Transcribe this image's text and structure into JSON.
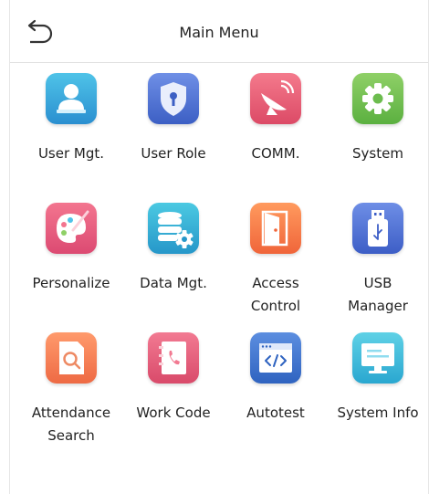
{
  "header": {
    "title": "Main Menu"
  },
  "menu": [
    {
      "label": "User Mgt.",
      "icon": "user-management-icon",
      "color_top": "#4fc3e8",
      "color_bottom": "#2a8fd0"
    },
    {
      "label": "User Role",
      "icon": "user-role-shield-icon",
      "color_top": "#6f8fe6",
      "color_bottom": "#3c5fc4"
    },
    {
      "label": "COMM.",
      "icon": "satellite-dish-icon",
      "color_top": "#f47a8c",
      "color_bottom": "#dc4a66"
    },
    {
      "label": "System",
      "icon": "gear-icon",
      "color_top": "#8fd067",
      "color_bottom": "#5bb040"
    },
    {
      "label": "Personalize",
      "icon": "palette-icon",
      "color_top": "#f3758f",
      "color_bottom": "#dc4a72"
    },
    {
      "label": "Data Mgt.",
      "icon": "database-gear-icon",
      "color_top": "#4bc9e2",
      "color_bottom": "#2697c9"
    },
    {
      "label": "Access\nControl",
      "icon": "door-icon",
      "color_top": "#ff9a5e",
      "color_bottom": "#f0653a"
    },
    {
      "label": "USB\nManager",
      "icon": "usb-drive-icon",
      "color_top": "#6e8ee6",
      "color_bottom": "#3d5ec6"
    },
    {
      "label": "Attendance\nSearch",
      "icon": "document-search-icon",
      "color_top": "#ff9a6c",
      "color_bottom": "#ee6a44"
    },
    {
      "label": "Work Code",
      "icon": "address-book-icon",
      "color_top": "#f27a92",
      "color_bottom": "#d94a6a"
    },
    {
      "label": "Autotest",
      "icon": "code-window-icon",
      "color_top": "#5c8ee0",
      "color_bottom": "#2f63c0"
    },
    {
      "label": "System Info",
      "icon": "monitor-icon",
      "color_top": "#5fd1e6",
      "color_bottom": "#2aa7d0"
    }
  ]
}
